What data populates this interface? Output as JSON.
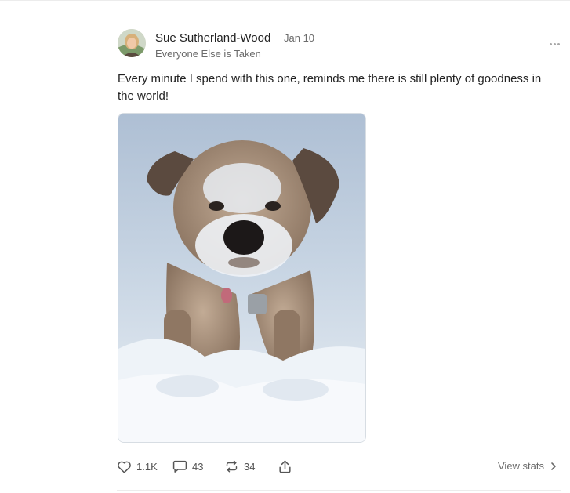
{
  "post": {
    "author": {
      "name": "Sue Sutherland-Wood",
      "publication": "Everyone Else is Taken"
    },
    "date": "Jan 10",
    "body": "Every minute I spend with this one, reminds me there is still plenty of goodness in the world!",
    "image": {
      "icon": "photo-of-snowy-dog"
    },
    "actions": {
      "likes": "1.1K",
      "comments": "43",
      "restacks": "34",
      "view_stats": "View stats"
    },
    "icons": [
      "heart-icon",
      "comment-icon",
      "restack-icon",
      "share-icon",
      "chevron-right-icon",
      "more-icon"
    ]
  }
}
